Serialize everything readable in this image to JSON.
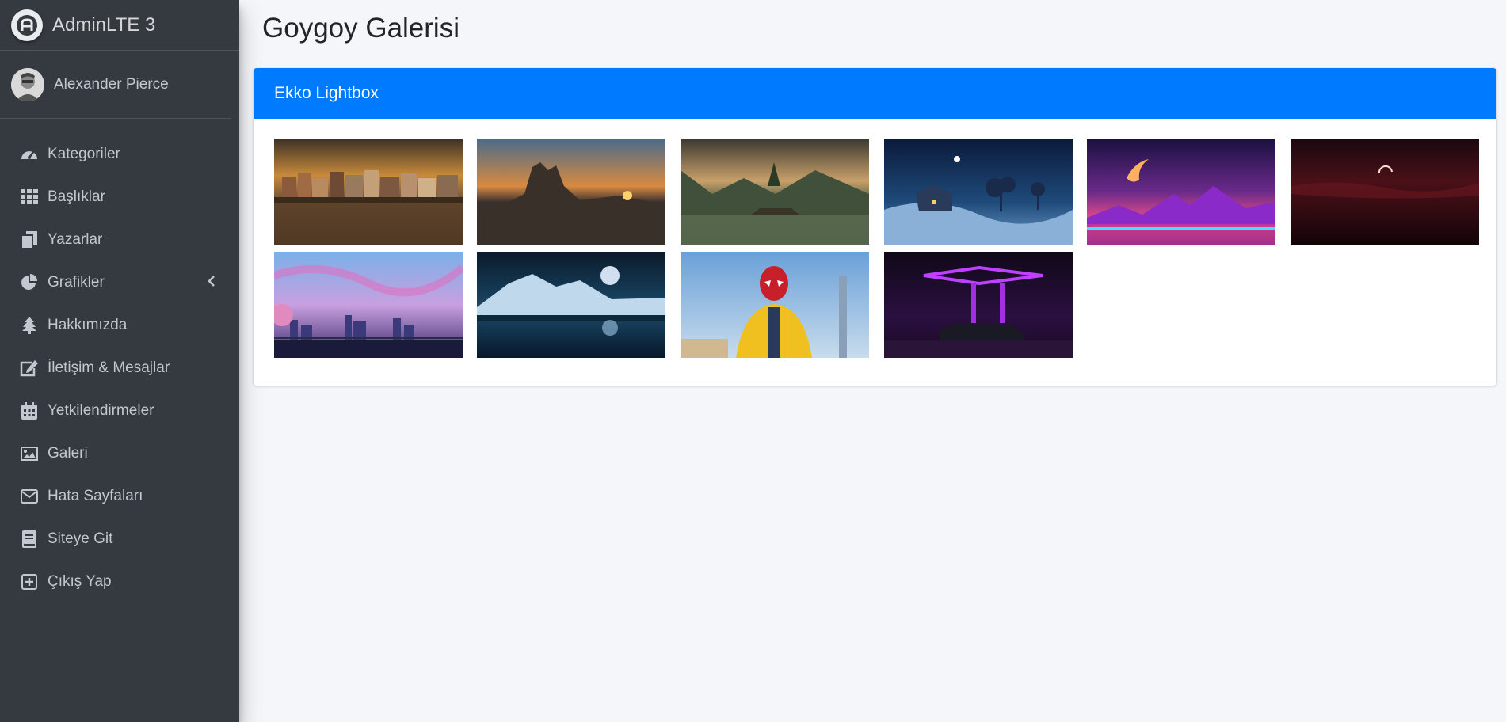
{
  "brand": {
    "name": "AdminLTE 3"
  },
  "user": {
    "name": "Alexander Pierce"
  },
  "nav": [
    {
      "label": "Kategoriler",
      "icon": "tachometer-icon"
    },
    {
      "label": "Başlıklar",
      "icon": "grid-icon"
    },
    {
      "label": "Yazarlar",
      "icon": "copy-icon"
    },
    {
      "label": "Grafikler",
      "icon": "pie-chart-icon",
      "has_submenu": true
    },
    {
      "label": "Hakkımızda",
      "icon": "tree-icon"
    },
    {
      "label": "İletişim & Mesajlar",
      "icon": "edit-icon"
    },
    {
      "label": "Yetkilendirmeler",
      "icon": "calendar-icon"
    },
    {
      "label": "Galeri",
      "icon": "image-icon"
    },
    {
      "label": "Hata Sayfaları",
      "icon": "envelope-icon"
    },
    {
      "label": "Siteye Git",
      "icon": "book-icon"
    },
    {
      "label": "Çıkış Yap",
      "icon": "plus-square-icon"
    }
  ],
  "page": {
    "title": "Goygoy Galerisi"
  },
  "card": {
    "title": "Ekko Lightbox"
  },
  "gallery": [
    {
      "name": "harbor-town-sunset"
    },
    {
      "name": "mountain-peak-sunrise"
    },
    {
      "name": "lake-island-tree"
    },
    {
      "name": "snowy-cabin-night"
    },
    {
      "name": "synthwave-mountains"
    },
    {
      "name": "dark-red-eclipse"
    },
    {
      "name": "anime-city-sky"
    },
    {
      "name": "moon-lake-mountains"
    },
    {
      "name": "spiderman-yellow-jacket"
    },
    {
      "name": "neon-gas-station"
    }
  ],
  "colors": {
    "sidebar": "#343a40",
    "primary": "#007bff",
    "background": "#f4f6f9"
  }
}
